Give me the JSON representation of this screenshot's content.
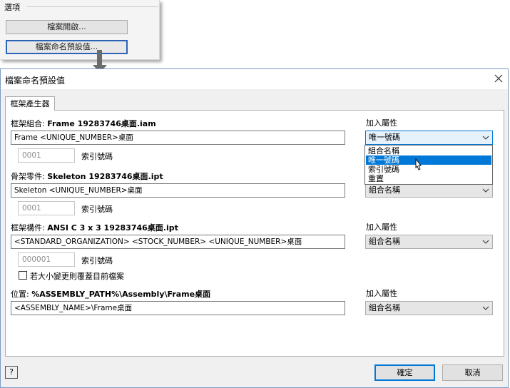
{
  "options_panel": {
    "title": "選項",
    "file_open_button": "檔案開啟...",
    "naming_defaults_button": "檔案命名預設值..."
  },
  "dialog": {
    "title": "檔案命名預設值",
    "close_icon": "close-icon",
    "tab_label": "框架產生器",
    "frame_assembly": {
      "label_prefix": "框架組合: ",
      "label_value": "Frame 19283746桌面.iam",
      "value": "Frame <UNIQUE_NUMBER>桌面",
      "index_value": "0001",
      "index_label": "索引號碼"
    },
    "skeleton_part": {
      "label_prefix": "骨架零件: ",
      "label_value": "Skeleton 19283746桌面.ipt",
      "value": "Skeleton <UNIQUE_NUMBER>桌面",
      "index_value": "0001",
      "index_label": "索引號碼"
    },
    "frame_member": {
      "label_prefix": "框架構件: ",
      "label_value": "ANSI C 3 x 3 19283746桌面.ipt",
      "value": "<STANDARD_ORGANIZATION> <STOCK_NUMBER> <UNIQUE_NUMBER>桌面",
      "index_value": "000001",
      "index_label": "索引號碼",
      "overwrite_label": "若大小變更則覆蓋目前檔案",
      "overwrite_checked": false
    },
    "location": {
      "label_prefix": "位置: ",
      "label_value": "%ASSEMBLY_PATH%\\Assembly\\Frame桌面",
      "value": "<ASSEMBLY_NAME>\\Frame桌面"
    },
    "add_property_label": "加入屬性",
    "combo1_value": "唯一號碼",
    "combo1_options": [
      "組合名稱",
      "唯一號碼",
      "索引號碼",
      "重置"
    ],
    "combo1_highlighted": "唯一號碼",
    "combo2_value": "組合名稱",
    "combo3_value": "組合名稱",
    "combo4_value": "組合名稱",
    "help_button": "?",
    "ok_button": "確定",
    "cancel_button": "取消",
    "colors": {
      "accent": "#0078d7",
      "dialog_border": "#7a9cc6",
      "selection_text": "#ffffff"
    }
  }
}
